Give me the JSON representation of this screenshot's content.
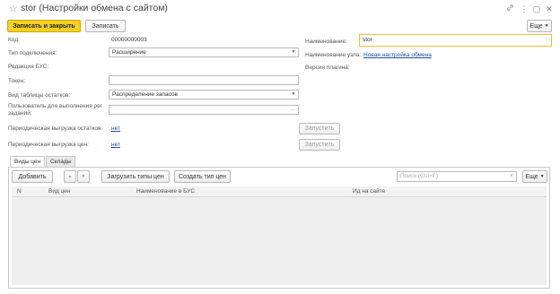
{
  "window": {
    "title": "stor (Настройки обмена с сайтом)"
  },
  "toolbar": {
    "save_close_label": "Записать и закрыть",
    "save_label": "Записать",
    "more_label": "Еще"
  },
  "form": {
    "code_label": "Код:",
    "code_value": "00000000003",
    "connection_type_label": "Тип подключения:",
    "connection_type_value": "Расширение",
    "bus_edition_label": "Редакция БУС:",
    "token_label": "Токен:",
    "token_value": "",
    "stock_table_label": "Вид таблицы остатков:",
    "stock_table_value": "Распределение запасов",
    "job_user_label": "Пользователь для выполнения рег заданий:",
    "job_user_value": "",
    "periodic_stock_label": "Периодическая выгрузка остатков:",
    "periodic_stock_value": "нет",
    "periodic_price_label": "Периодическая выгрузка цен:",
    "periodic_price_value": "нет",
    "run_label": "Запустить",
    "name_label": "Наименование:",
    "name_value": "stor",
    "node_name_label": "Наименование узла:",
    "node_name_value": "Новая настройка обмена",
    "plugin_version_label": "Версия плагина:"
  },
  "tabs": [
    {
      "label": "Виды цен"
    },
    {
      "label": "Склады"
    }
  ],
  "table_toolbar": {
    "add_label": "Добавить",
    "load_label": "Загрузить типы цен",
    "create_label": "Создать тип цен",
    "search_placeholder": "Поиск (Ctrl+F)",
    "more_label": "Еще"
  },
  "table": {
    "columns": [
      "N",
      "Вид цен",
      "Наименование в БУС",
      "Ид на сайте"
    ]
  },
  "icons": {
    "star": "☆",
    "link": "🔗",
    "more_vertical": "⋮",
    "maximize": "▢",
    "close": "✕",
    "up": "▲",
    "down": "▼",
    "dropdown": "▼",
    "ellipsis": "...",
    "search_clear": "×"
  }
}
